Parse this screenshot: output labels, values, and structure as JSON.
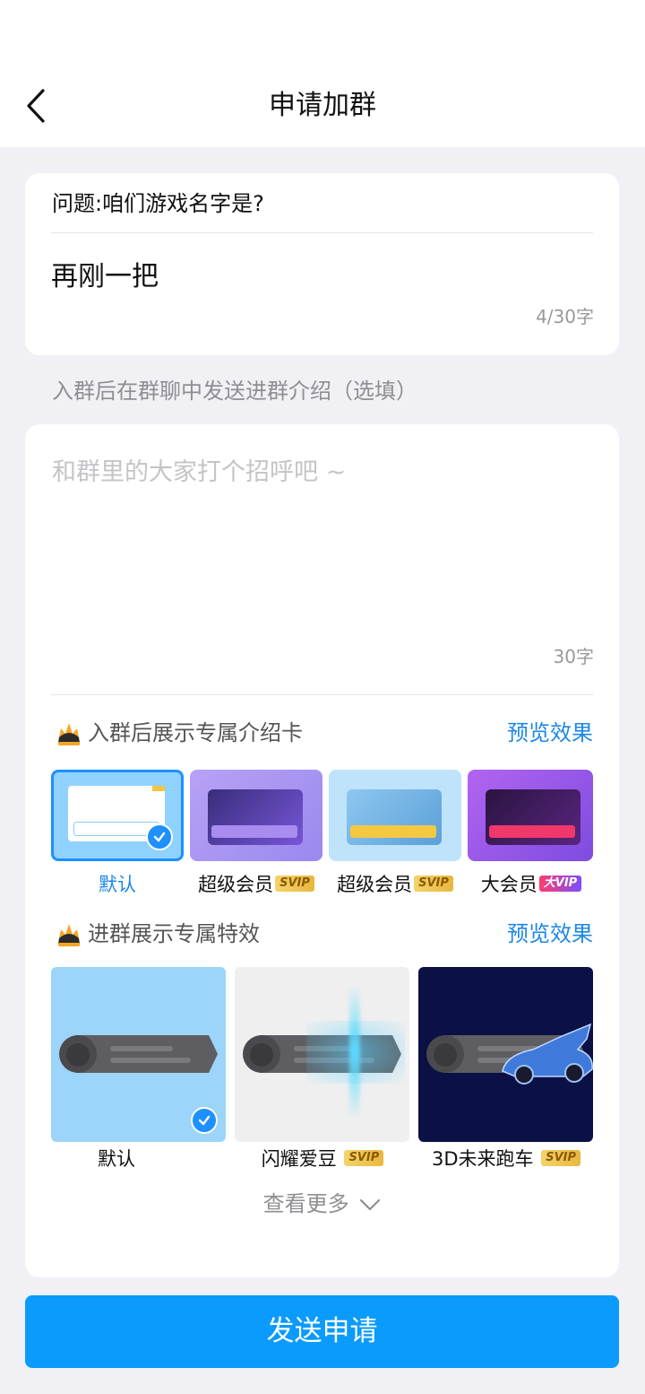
{
  "header": {
    "title": "申请加群"
  },
  "answer": {
    "question": "问题:咱们游戏名字是?",
    "value": "再刚一把",
    "count": "4/30字"
  },
  "intro": {
    "label": "入群后在群聊中发送进群介绍（选填）",
    "placeholder": "和群里的大家打个招呼吧 ~",
    "count": "30字"
  },
  "intro_card_section": {
    "title": "入群后展示专属介绍卡",
    "preview": "预览效果",
    "items": [
      {
        "label": "默认",
        "badge": "",
        "selected": true
      },
      {
        "label": "超级会员",
        "badge": "SVIP",
        "selected": false
      },
      {
        "label": "超级会员",
        "badge": "SVIP",
        "selected": false
      },
      {
        "label": "大会员",
        "badge": "大VIP",
        "selected": false
      }
    ]
  },
  "effect_section": {
    "title": "进群展示专属特效",
    "preview": "预览效果",
    "items": [
      {
        "label": "默认",
        "badge": "",
        "selected": true
      },
      {
        "label": "闪耀爱豆",
        "badge": "SVIP",
        "selected": false
      },
      {
        "label": "3D未来跑车",
        "badge": "SVIP",
        "selected": false
      }
    ]
  },
  "more": "查看更多",
  "send_button": "发送申请",
  "colors": {
    "accent": "#0A9BFC",
    "link": "#1E88E5",
    "background": "#F0F0F5"
  }
}
